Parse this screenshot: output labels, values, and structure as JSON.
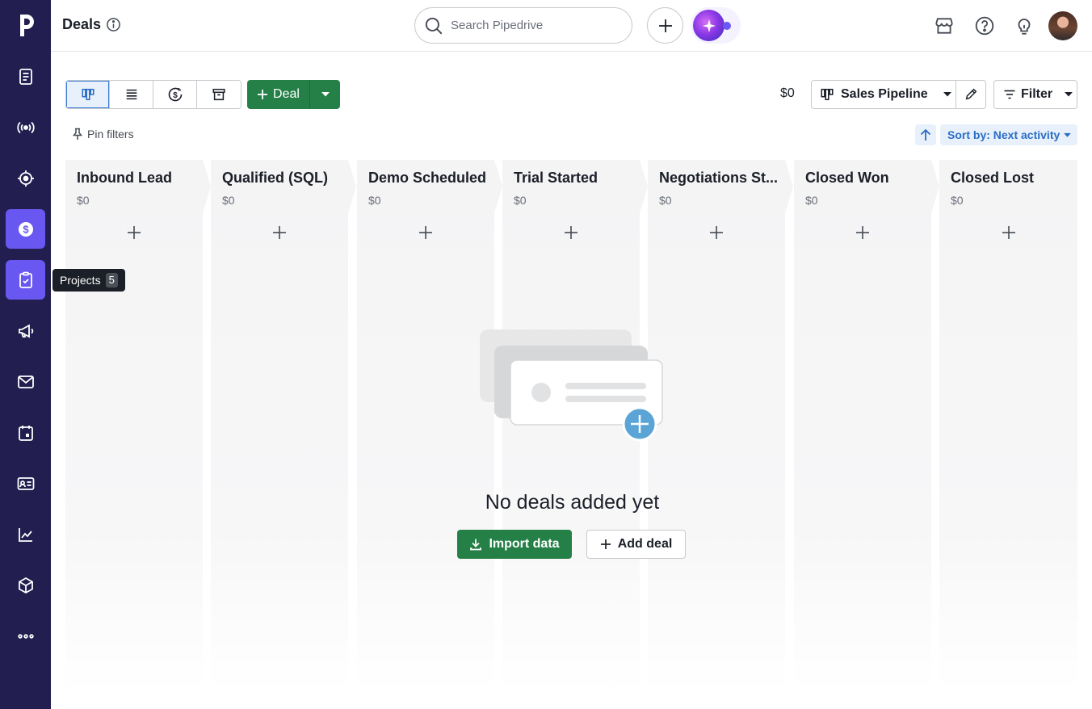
{
  "sidebar": {
    "items": [
      {
        "name": "leads",
        "icon": "leads-inbox-icon"
      },
      {
        "name": "campaigns-live",
        "icon": "broadcast-icon"
      },
      {
        "name": "focus",
        "icon": "target-icon"
      },
      {
        "name": "deals",
        "icon": "dollar-icon",
        "active": true
      },
      {
        "name": "projects",
        "icon": "clipboard-check-icon",
        "hover": true
      },
      {
        "name": "campaigns",
        "icon": "megaphone-icon"
      },
      {
        "name": "mail",
        "icon": "envelope-icon"
      },
      {
        "name": "activities",
        "icon": "calendar-icon"
      },
      {
        "name": "contacts",
        "icon": "contact-card-icon"
      },
      {
        "name": "insights",
        "icon": "line-chart-icon"
      },
      {
        "name": "products",
        "icon": "box-icon"
      },
      {
        "name": "more",
        "icon": "more-dots-icon"
      }
    ],
    "tooltip": {
      "label": "Projects",
      "count": "5"
    }
  },
  "header": {
    "title": "Deals",
    "search_placeholder": "Search Pipedrive"
  },
  "toolbar": {
    "add_deal_label": "Deal",
    "total": "$0",
    "pipeline": "Sales Pipeline",
    "filter_label": "Filter",
    "pin_filters_label": "Pin filters",
    "sort_label": "Sort by: Next activity"
  },
  "stages": [
    {
      "title": "Inbound Lead",
      "amount": "$0"
    },
    {
      "title": "Qualified (SQL)",
      "amount": "$0"
    },
    {
      "title": "Demo Scheduled",
      "amount": "$0"
    },
    {
      "title": "Trial Started",
      "amount": "$0"
    },
    {
      "title": "Negotiations St...",
      "amount": "$0"
    },
    {
      "title": "Closed Won",
      "amount": "$0"
    },
    {
      "title": "Closed Lost",
      "amount": "$0"
    }
  ],
  "empty_state": {
    "title": "No deals added yet",
    "import_label": "Import data",
    "add_label": "Add deal"
  },
  "colors": {
    "sidebar_bg": "#221e4f",
    "sidebar_active": "#6857f0",
    "primary_green": "#258047",
    "link_blue": "#2a6cc4"
  }
}
